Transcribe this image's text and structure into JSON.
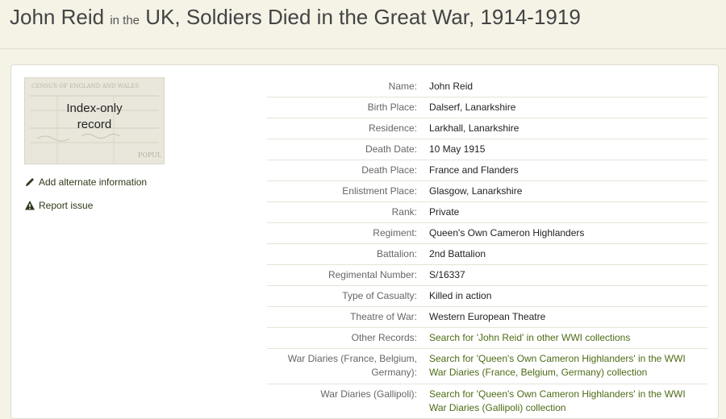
{
  "header": {
    "name": "John Reid",
    "connector": "in the",
    "collection": "UK, Soldiers Died in the Great War, 1914-1919"
  },
  "thumbnail": {
    "caption_line1": "Index-only",
    "caption_line2": "record",
    "bg_text": "CENSUS OF ENGLAND AND WALES",
    "bg_text2": "POPUL"
  },
  "actions": {
    "add_alternate": "Add alternate information",
    "report_issue": "Report issue"
  },
  "record": [
    {
      "label": "Name:",
      "value": "John Reid"
    },
    {
      "label": "Birth Place:",
      "value": "Dalserf, Lanarkshire"
    },
    {
      "label": "Residence:",
      "value": "Larkhall, Lanarkshire"
    },
    {
      "label": "Death Date:",
      "value": "10 May 1915"
    },
    {
      "label": "Death Place:",
      "value": "France and Flanders"
    },
    {
      "label": "Enlistment Place:",
      "value": "Glasgow, Lanarkshire"
    },
    {
      "label": "Rank:",
      "value": "Private"
    },
    {
      "label": "Regiment:",
      "value": "Queen's Own Cameron Highlanders"
    },
    {
      "label": "Battalion:",
      "value": "2nd Battalion"
    },
    {
      "label": "Regimental Number:",
      "value": "S/16337"
    },
    {
      "label": "Type of Casualty:",
      "value": "Killed in action"
    },
    {
      "label": "Theatre of War:",
      "value": "Western European Theatre"
    },
    {
      "label": "Other Records:",
      "value": "Search for 'John Reid' in other WWI collections",
      "link": true
    },
    {
      "label": "War Diaries (France, Belgium, Germany):",
      "value": "Search for 'Queen's Own Cameron Highlanders' in the WWI War Diaries (France, Belgium, Germany) collection",
      "link": true
    },
    {
      "label": "War Diaries (Gallipoli):",
      "value": "Search for 'Queen's Own Cameron Highlanders' in the WWI War Diaries (Gallipoli) collection",
      "link": true
    }
  ],
  "colors": {
    "page_bg": "#f5f2e6",
    "link": "#4d6b15",
    "action_text": "#2f3b1a"
  }
}
